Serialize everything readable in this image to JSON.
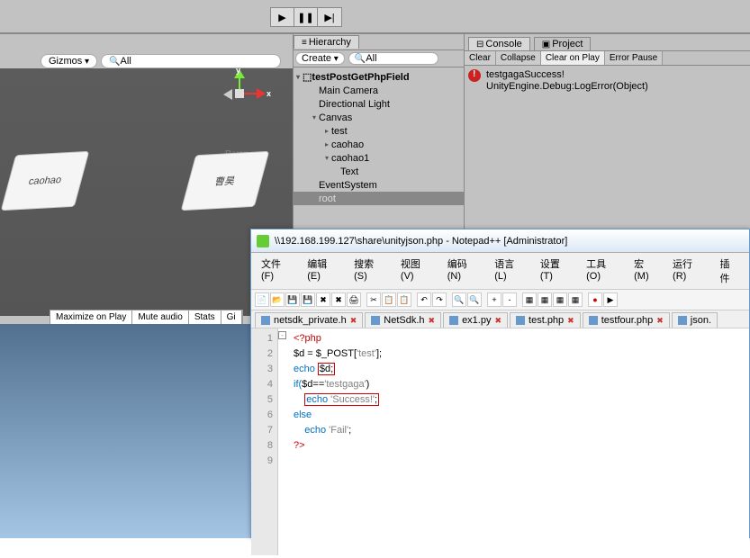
{
  "playbar": {
    "play": "▶",
    "pause": "❚❚",
    "step": "▶|"
  },
  "gizmos": {
    "label": "Gizmos",
    "search": "All"
  },
  "scene": {
    "card1": "caohao",
    "card2": "曹昊",
    "persp": "Persp",
    "axisX": "x",
    "axisY": "y"
  },
  "footer": {
    "max": "Maximize on Play",
    "mute": "Mute audio",
    "stats": "Stats",
    "giz": "Gi"
  },
  "hierarchy": {
    "title": "Hierarchy",
    "create": "Create",
    "search": "All",
    "sceneName": "testPostGetPhpField",
    "items": [
      "Main Camera",
      "Directional Light",
      "Canvas",
      "test",
      "caohao",
      "caohao1",
      "Text",
      "EventSystem",
      "root"
    ]
  },
  "console": {
    "tab1": "Console",
    "tab2": "Project",
    "btns": {
      "clear": "Clear",
      "collapse": "Collapse",
      "cop": "Clear on Play",
      "err": "Error Pause"
    },
    "msg1": "testgagaSuccess!",
    "msg2": "UnityEngine.Debug:LogError(Object)"
  },
  "npp": {
    "title": "\\\\192.168.199.127\\share\\unityjson.php - Notepad++ [Administrator]",
    "menu": [
      "文件(F)",
      "编辑(E)",
      "搜索(S)",
      "视图(V)",
      "编码(N)",
      "语言(L)",
      "设置(T)",
      "工具(O)",
      "宏(M)",
      "运行(R)",
      "插件"
    ],
    "tabs": [
      "netsdk_private.h",
      "NetSdk.h",
      "ex1.py",
      "test.php",
      "testfour.php",
      "json."
    ],
    "lines": [
      "1",
      "2",
      "3",
      "4",
      "5",
      "6",
      "7",
      "8",
      "9"
    ],
    "code": {
      "l1a": "<?php",
      "l2a": "$d = $_POST[",
      "l2b": "'test'",
      "l2c": "];",
      "l3a": "echo ",
      "l3b": "$d;",
      "l4a": "if(",
      "l4b": "$d==",
      "l4c": "'testgaga'",
      "l4d": ")",
      "l5a": "echo ",
      "l5b": "'Success!'",
      "l5c": ";",
      "l6a": "else",
      "l7a": "echo ",
      "l7b": "'Fail'",
      "l7c": ";",
      "l8a": "?>"
    }
  }
}
